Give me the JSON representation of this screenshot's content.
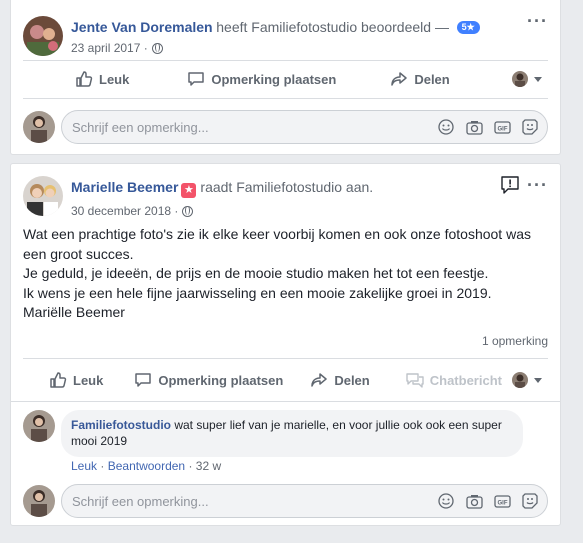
{
  "post1": {
    "author": "Jente Van Doremalen",
    "action_text": "heeft Familiefotostudio beoordeeld —",
    "rating_badge": "5★",
    "date": "23 april 2017 ·",
    "actions": {
      "like": "Leuk",
      "comment": "Opmerking plaatsen",
      "share": "Delen"
    },
    "composer_placeholder": "Schrijf een opmerking..."
  },
  "post2": {
    "author": "Marielle Beemer",
    "action_text": "raadt Familiefotostudio aan.",
    "date": "30 december 2018 ·",
    "body": [
      "Wat een prachtige foto's zie ik elke keer voorbij komen en ook onze fotoshoot was een groot succes.",
      "Je geduld, je ideeën, de prijs en de mooie studio maken het tot een feestje.",
      "Ik wens je een hele fijne jaarwisseling en een mooie zakelijke groei in 2019.",
      "Mariëlle Beemer"
    ],
    "comment_count": "1 opmerking",
    "actions": {
      "like": "Leuk",
      "comment": "Opmerking plaatsen",
      "share": "Delen",
      "chat": "Chatbericht"
    },
    "comment": {
      "author": "Familiefotostudio",
      "text": "wat super lief van je marielle, en voor jullie ook ook een super mooi 2019",
      "like": "Leuk",
      "reply": "Beantwoorden",
      "age": "32 w"
    },
    "composer_placeholder": "Schrijf een opmerking..."
  },
  "colors": {
    "link": "#365899",
    "muted": "#606770",
    "badge": "#4080ff",
    "recommend": "#f35369",
    "background": "#e9ebee"
  },
  "icons": [
    "thumbs-up-icon",
    "comment-icon",
    "share-icon",
    "chat-icon",
    "globe-icon",
    "emoji-icon",
    "camera-icon",
    "gif-icon",
    "sticker-icon",
    "report-icon",
    "more-icon",
    "chevron-down-icon"
  ]
}
